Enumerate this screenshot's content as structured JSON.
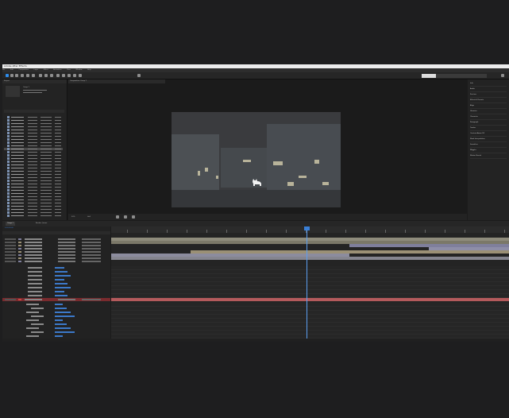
{
  "app": {
    "title": "Adobe After Effects"
  },
  "menu": [
    "File",
    "Edit",
    "Composition",
    "Layer",
    "Effect",
    "Animation",
    "View",
    "Window",
    "Help"
  ],
  "project": {
    "tab": "Project",
    "name": "Comp 1"
  },
  "composition": {
    "tab": "Composition Comp 1",
    "zoom": "50%",
    "resolution": "Half"
  },
  "right_panel": [
    "Info",
    "Audio",
    "Preview",
    "Effects & Presets",
    "Align",
    "Libraries",
    "Character",
    "Paragraph",
    "Tracker",
    "Content-Aware Fill",
    "Mask Interpolation",
    "Smoother",
    "Wiggler",
    "Motion Sketch"
  ],
  "timeline": {
    "tabs": [
      "Comp 1",
      "Render Queue"
    ],
    "timecode": "0:00:00:00"
  },
  "colors": {
    "accent": "#2d8ceb",
    "label_red": "#7a2b2e",
    "label_tan": "#9b9075",
    "label_lavender": "#7f7f9c"
  },
  "icons": [
    "selection-tool-icon",
    "hand-tool-icon",
    "zoom-tool-icon",
    "rotate-tool-icon",
    "camera-tool-icon",
    "pan-behind-icon",
    "rectangle-tool-icon",
    "pen-tool-icon",
    "type-tool-icon",
    "brush-tool-icon",
    "clone-stamp-icon",
    "eraser-icon",
    "roto-brush-icon",
    "puppet-tool-icon"
  ]
}
